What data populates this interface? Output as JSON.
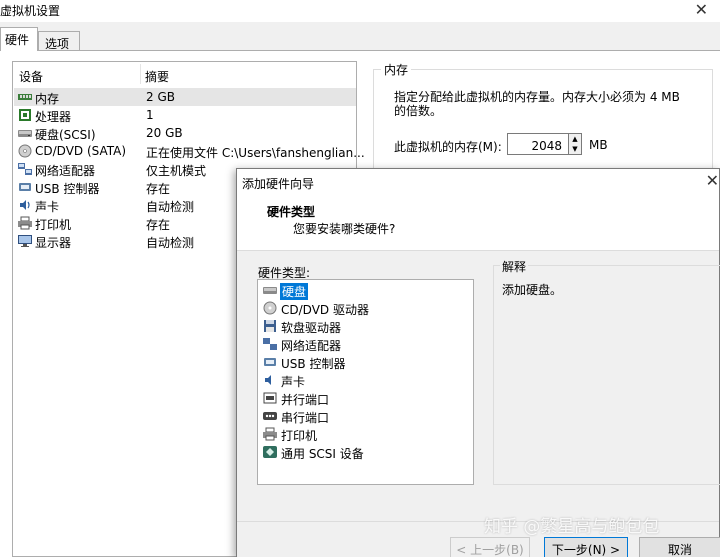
{
  "window": {
    "title": "虚拟机设置",
    "close": "✕"
  },
  "tabs": [
    {
      "label": "硬件"
    },
    {
      "label": "选项"
    }
  ],
  "device_table": {
    "headers": {
      "device": "设备",
      "summary": "摘要"
    },
    "rows": [
      {
        "name": "内存",
        "summary": "2 GB",
        "icon": "memory-icon"
      },
      {
        "name": "处理器",
        "summary": "1",
        "icon": "processor-icon"
      },
      {
        "name": "硬盘(SCSI)",
        "summary": "20 GB",
        "icon": "hard-disk-icon"
      },
      {
        "name": "CD/DVD (SATA)",
        "summary": "正在使用文件 C:\\Users\\fanshenglian...",
        "icon": "cd-dvd-icon"
      },
      {
        "name": "网络适配器",
        "summary": "仅主机模式",
        "icon": "network-adapter-icon"
      },
      {
        "name": "USB 控制器",
        "summary": "存在",
        "icon": "usb-icon"
      },
      {
        "name": "声卡",
        "summary": "自动检测",
        "icon": "sound-card-icon"
      },
      {
        "name": "打印机",
        "summary": "存在",
        "icon": "printer-icon"
      },
      {
        "name": "显示器",
        "summary": "自动检测",
        "icon": "display-icon"
      }
    ]
  },
  "memory": {
    "legend": "内存",
    "description": "指定分配给此虚拟机的内存量。内存大小必须为 4 MB 的倍数。",
    "label": "此虚拟机的内存(M):",
    "value": "2048",
    "unit": "MB"
  },
  "wizard": {
    "title": "添加硬件向导",
    "close": "✕",
    "header_title": "硬件类型",
    "header_subtitle": "您要安装哪类硬件?",
    "list_label": "硬件类型:",
    "items": [
      {
        "label": "硬盘",
        "icon": "hard-disk-icon"
      },
      {
        "label": "CD/DVD 驱动器",
        "icon": "cd-dvd-icon"
      },
      {
        "label": "软盘驱动器",
        "icon": "floppy-icon"
      },
      {
        "label": "网络适配器",
        "icon": "network-adapter-icon"
      },
      {
        "label": "USB 控制器",
        "icon": "usb-icon"
      },
      {
        "label": "声卡",
        "icon": "sound-card-icon"
      },
      {
        "label": "并行端口",
        "icon": "parallel-port-icon"
      },
      {
        "label": "串行端口",
        "icon": "serial-port-icon"
      },
      {
        "label": "打印机",
        "icon": "printer-icon"
      },
      {
        "label": "通用 SCSI 设备",
        "icon": "scsi-icon"
      }
    ],
    "explanation_legend": "解释",
    "explanation_text": "添加硬盘。",
    "buttons": {
      "back": "< 上一步(B)",
      "next": "下一步(N) >",
      "cancel": "取消"
    }
  },
  "watermark": "知乎 @繁星高与鲍包包",
  "colors": {
    "selection": "#0078d7",
    "row_selected": "#e5e5e5"
  }
}
